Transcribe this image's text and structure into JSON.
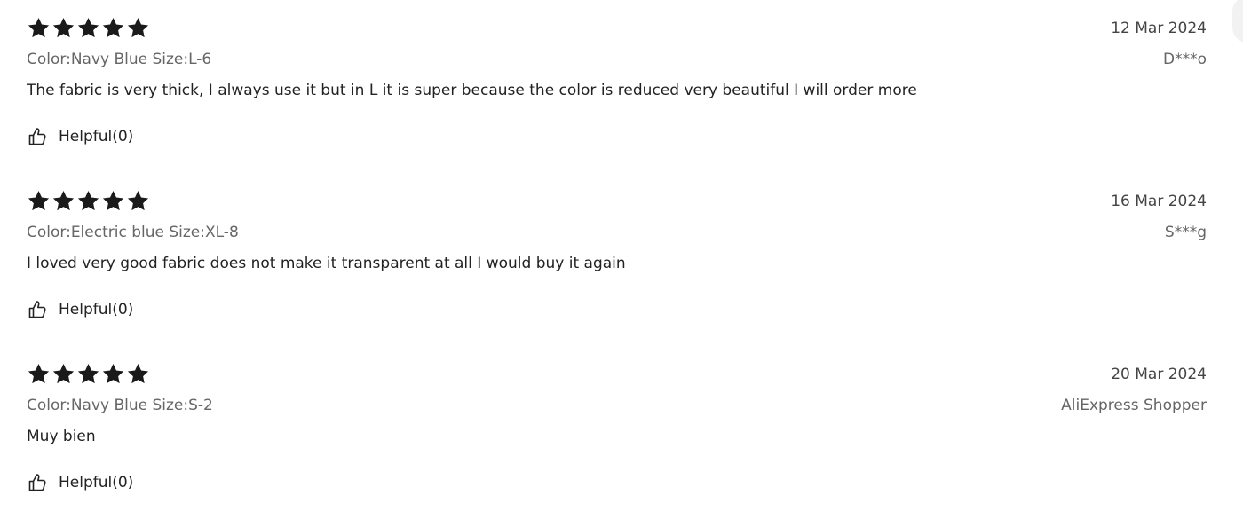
{
  "colors": {
    "star": "#1a1a1a",
    "text_primary": "#222222",
    "text_secondary": "#666666"
  },
  "icons": {
    "star": "star-icon",
    "helpful": "thumbs-up-icon"
  },
  "reviews": [
    {
      "rating": 5,
      "date": "12 Mar 2024",
      "sku": "Color:Navy Blue Size:L-6",
      "author": "D***o",
      "text": "The fabric is very thick, I always use it but in L it is super because the color is reduced very beautiful I will order more",
      "helpful_label": "Helpful(0)"
    },
    {
      "rating": 5,
      "date": "16 Mar 2024",
      "sku": "Color:Electric blue Size:XL-8",
      "author": "S***g",
      "text": "I loved very good fabric does not make it transparent at all I would buy it again",
      "helpful_label": "Helpful(0)"
    },
    {
      "rating": 5,
      "date": "20 Mar 2024",
      "sku": "Color:Navy Blue Size:S-2",
      "author": "AliExpress Shopper",
      "text": "Muy bien",
      "helpful_label": "Helpful(0)"
    }
  ]
}
